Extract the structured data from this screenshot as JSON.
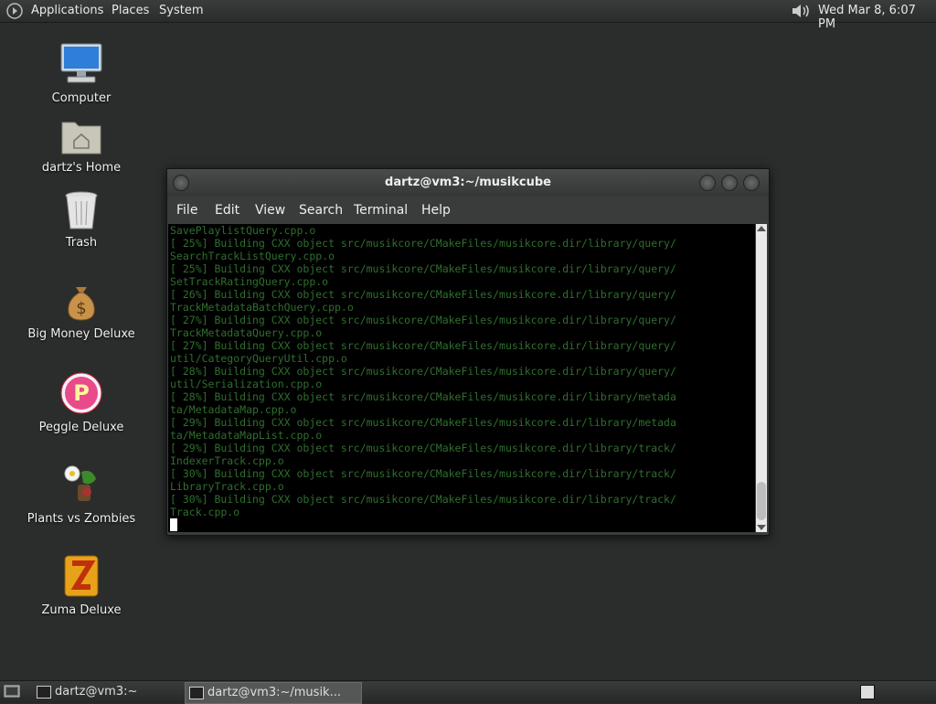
{
  "top_panel": {
    "menus": [
      "Applications",
      "Places",
      "System"
    ],
    "clock": "Wed Mar  8,  6:07 PM"
  },
  "desktop_icons": [
    {
      "label": "Computer",
      "icon": "computer-icon"
    },
    {
      "label": "dartz's Home",
      "icon": "home-folder-icon"
    },
    {
      "label": "Trash",
      "icon": "trash-icon"
    },
    {
      "label": "Big Money Deluxe",
      "icon": "money-bag-icon"
    },
    {
      "label": "Peggle Deluxe",
      "icon": "peggle-icon"
    },
    {
      "label": "Plants vs Zombies",
      "icon": "plants-vs-zombies-icon"
    },
    {
      "label": "Zuma Deluxe",
      "icon": "zuma-icon"
    }
  ],
  "terminal": {
    "title": "dartz@vm3:~/musikcube",
    "menu": [
      "File",
      "Edit",
      "View",
      "Search",
      "Terminal",
      "Help"
    ],
    "lines": [
      "SavePlaylistQuery.cpp.o",
      "[ 25%] Building CXX object src/musikcore/CMakeFiles/musikcore.dir/library/query/",
      "SearchTrackListQuery.cpp.o",
      "[ 25%] Building CXX object src/musikcore/CMakeFiles/musikcore.dir/library/query/",
      "SetTrackRatingQuery.cpp.o",
      "[ 26%] Building CXX object src/musikcore/CMakeFiles/musikcore.dir/library/query/",
      "TrackMetadataBatchQuery.cpp.o",
      "[ 27%] Building CXX object src/musikcore/CMakeFiles/musikcore.dir/library/query/",
      "TrackMetadataQuery.cpp.o",
      "[ 27%] Building CXX object src/musikcore/CMakeFiles/musikcore.dir/library/query/",
      "util/CategoryQueryUtil.cpp.o",
      "[ 28%] Building CXX object src/musikcore/CMakeFiles/musikcore.dir/library/query/",
      "util/Serialization.cpp.o",
      "[ 28%] Building CXX object src/musikcore/CMakeFiles/musikcore.dir/library/metada",
      "ta/MetadataMap.cpp.o",
      "[ 29%] Building CXX object src/musikcore/CMakeFiles/musikcore.dir/library/metada",
      "ta/MetadataMapList.cpp.o",
      "[ 29%] Building CXX object src/musikcore/CMakeFiles/musikcore.dir/library/track/",
      "IndexerTrack.cpp.o",
      "[ 30%] Building CXX object src/musikcore/CMakeFiles/musikcore.dir/library/track/",
      "LibraryTrack.cpp.o",
      "[ 30%] Building CXX object src/musikcore/CMakeFiles/musikcore.dir/library/track/",
      "Track.cpp.o"
    ]
  },
  "taskbar": {
    "tasks": [
      "dartz@vm3:~",
      "dartz@vm3:~/musik..."
    ]
  }
}
